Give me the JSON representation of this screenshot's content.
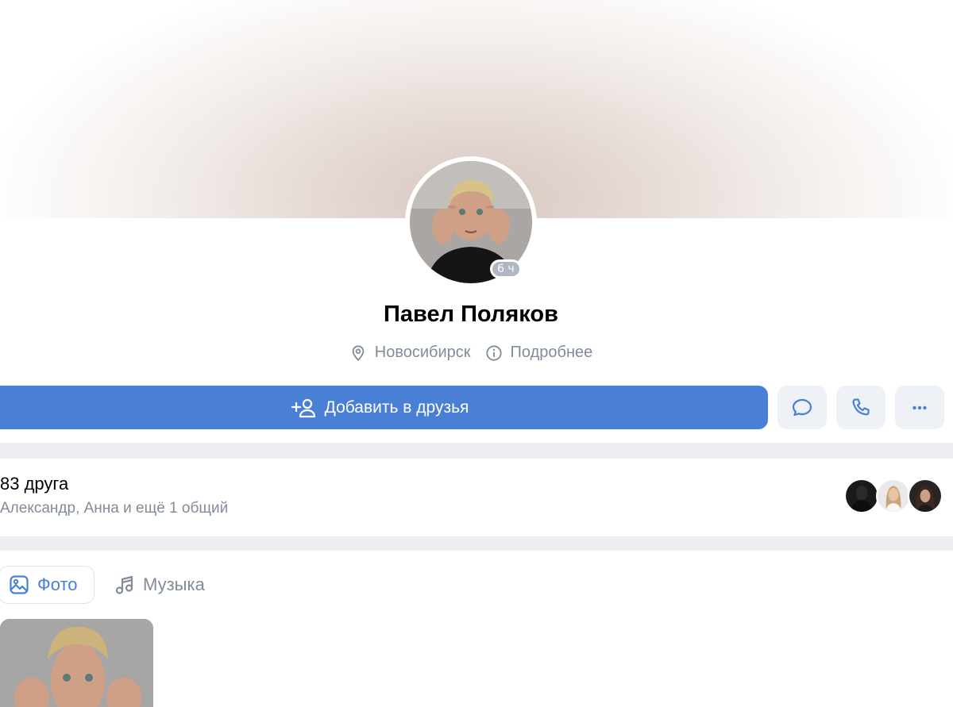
{
  "profile": {
    "name": "Павел Поляков",
    "last_seen": "6 ч",
    "city": "Новосибирск",
    "more_info_label": "Подробнее"
  },
  "actions": {
    "add_friend_label": "Добавить в друзья",
    "message_icon": "message-bubble-icon",
    "call_icon": "phone-icon",
    "more_icon": "more-horizontal-icon"
  },
  "friends": {
    "count_label": "83 друга",
    "mutual_label": "Александр, Анна и ещё 1 общий"
  },
  "media_tabs": [
    {
      "label": "Фото",
      "icon": "picture-icon",
      "active": true
    },
    {
      "label": "Музыка",
      "icon": "music-note-icon",
      "active": false
    }
  ],
  "colors": {
    "accent": "#4a7fd6",
    "secondary_text": "#818c99",
    "background": "#ebedf0",
    "button_secondary": "#eef1f5"
  }
}
